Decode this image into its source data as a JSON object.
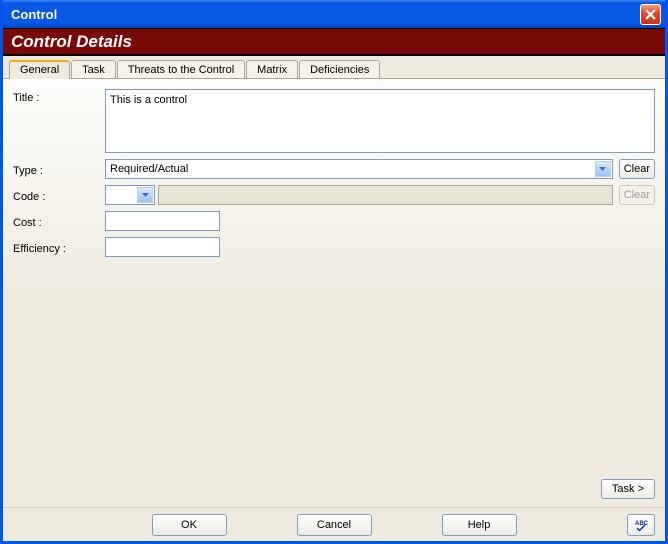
{
  "window": {
    "title": "Control"
  },
  "header": {
    "title": "Control Details"
  },
  "tabs": [
    {
      "label": "General",
      "active": true
    },
    {
      "label": "Task",
      "active": false
    },
    {
      "label": "Threats to the Control",
      "active": false
    },
    {
      "label": "Matrix",
      "active": false
    },
    {
      "label": "Deficiencies",
      "active": false
    }
  ],
  "form": {
    "title_label": "Title :",
    "title_value": "This is a control",
    "type_label": "Type :",
    "type_value": "Required/Actual",
    "type_clear": "Clear",
    "code_label": "Code :",
    "code_value": "",
    "code_readonly": "",
    "code_clear": "Clear",
    "cost_label": "Cost :",
    "cost_value": "",
    "efficiency_label": "Efficiency :",
    "efficiency_value": ""
  },
  "nav": {
    "task": "Task >"
  },
  "footer": {
    "ok": "OK",
    "cancel": "Cancel",
    "help": "Help"
  }
}
